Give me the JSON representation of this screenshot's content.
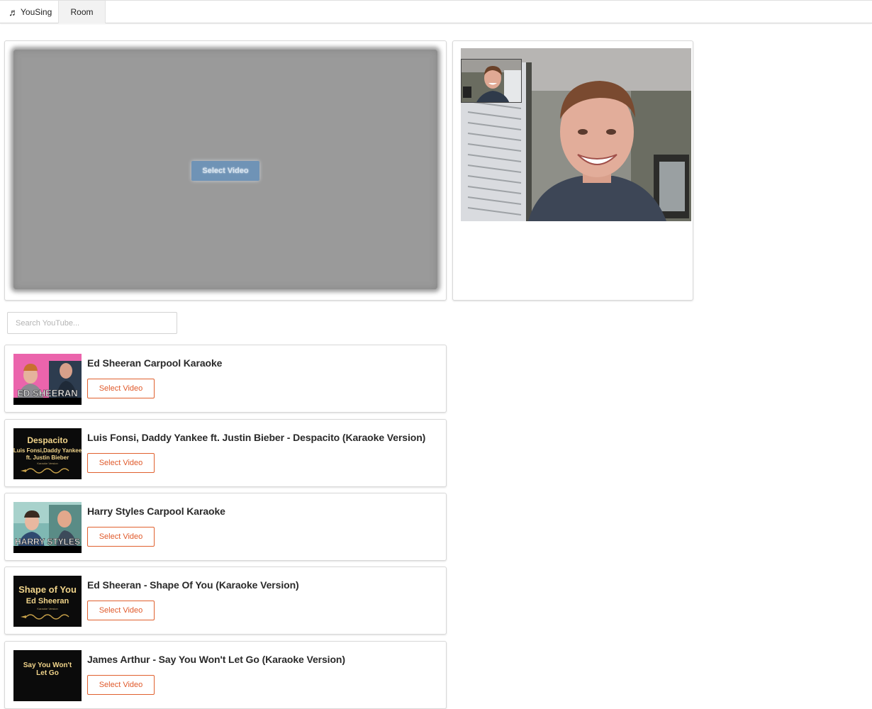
{
  "nav": {
    "brand": "YouSing",
    "brand_icon": "music-note-icon",
    "tab": "Room"
  },
  "player": {
    "select_label": "Select Video"
  },
  "camera": {
    "main_feed": "webcam-remote",
    "pip_feed": "webcam-local"
  },
  "search": {
    "placeholder": "Search YouTube...",
    "value": ""
  },
  "results": [
    {
      "title": "Ed Sheeran Carpool Karaoke",
      "button": "Select Video",
      "thumb_text": "ED SHEERAN"
    },
    {
      "title": "Luis Fonsi, Daddy Yankee ft. Justin Bieber - Despacito (Karaoke Version)",
      "button": "Select Video",
      "thumb_text": [
        "Despacito",
        "Luis Fonsi,Daddy Yankee",
        "ft. Justin Bieber",
        "Karaoke Version"
      ]
    },
    {
      "title": "Harry Styles Carpool Karaoke",
      "button": "Select Video",
      "thumb_text": "HARRY STYLES"
    },
    {
      "title": "Ed Sheeran - Shape Of You (Karaoke Version)",
      "button": "Select Video",
      "thumb_text": [
        "Shape of You",
        "Ed Sheeran",
        "Karaoke Version"
      ]
    },
    {
      "title": "James Arthur - Say You Won't Let Go (Karaoke Version)",
      "button": "Select Video",
      "thumb_text": [
        "Say You Won't",
        "Let Go"
      ]
    }
  ],
  "colors": {
    "accent": "#e0602e",
    "player_button": "#6f93b6"
  }
}
